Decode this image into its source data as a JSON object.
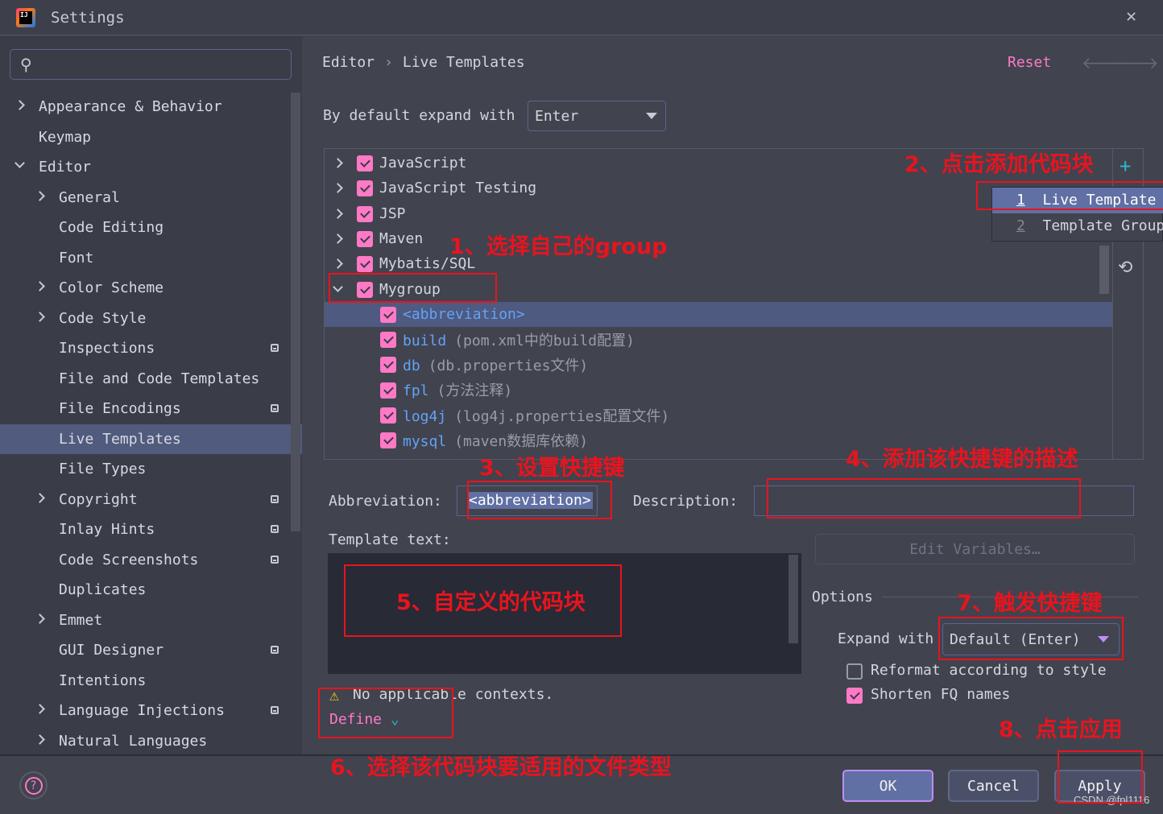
{
  "window": {
    "title": "Settings"
  },
  "search": {
    "placeholder": ""
  },
  "sidebar": {
    "items": [
      {
        "label": "Appearance & Behavior",
        "level": 0,
        "chevron": "closed",
        "badge": false
      },
      {
        "label": "Keymap",
        "level": 0,
        "chevron": "none",
        "badge": false
      },
      {
        "label": "Editor",
        "level": 0,
        "chevron": "open",
        "badge": false
      },
      {
        "label": "General",
        "level": 1,
        "chevron": "closed",
        "badge": false
      },
      {
        "label": "Code Editing",
        "level": 1,
        "chevron": "none",
        "badge": false
      },
      {
        "label": "Font",
        "level": 1,
        "chevron": "none",
        "badge": false
      },
      {
        "label": "Color Scheme",
        "level": 1,
        "chevron": "closed",
        "badge": false
      },
      {
        "label": "Code Style",
        "level": 1,
        "chevron": "closed",
        "badge": false
      },
      {
        "label": "Inspections",
        "level": 1,
        "chevron": "none",
        "badge": true
      },
      {
        "label": "File and Code Templates",
        "level": 1,
        "chevron": "none",
        "badge": false
      },
      {
        "label": "File Encodings",
        "level": 1,
        "chevron": "none",
        "badge": true
      },
      {
        "label": "Live Templates",
        "level": 1,
        "chevron": "none",
        "badge": false,
        "selected": true
      },
      {
        "label": "File Types",
        "level": 1,
        "chevron": "none",
        "badge": false
      },
      {
        "label": "Copyright",
        "level": 1,
        "chevron": "closed",
        "badge": true
      },
      {
        "label": "Inlay Hints",
        "level": 1,
        "chevron": "none",
        "badge": true
      },
      {
        "label": "Code Screenshots",
        "level": 1,
        "chevron": "none",
        "badge": true
      },
      {
        "label": "Duplicates",
        "level": 1,
        "chevron": "none",
        "badge": false
      },
      {
        "label": "Emmet",
        "level": 1,
        "chevron": "closed",
        "badge": false
      },
      {
        "label": "GUI Designer",
        "level": 1,
        "chevron": "none",
        "badge": true
      },
      {
        "label": "Intentions",
        "level": 1,
        "chevron": "none",
        "badge": false
      },
      {
        "label": "Language Injections",
        "level": 1,
        "chevron": "closed",
        "badge": true
      },
      {
        "label": "Natural Languages",
        "level": 1,
        "chevron": "closed",
        "badge": false
      }
    ]
  },
  "header": {
    "breadcrumb": [
      "Editor",
      "Live Templates"
    ],
    "separator": "›",
    "reset": "Reset"
  },
  "expand_default": {
    "label": "By default expand with",
    "value": "Enter"
  },
  "tree": {
    "rows": [
      {
        "abbr": "JavaScript",
        "group": true,
        "chevron": "closed"
      },
      {
        "abbr": "JavaScript Testing",
        "group": true,
        "chevron": "closed"
      },
      {
        "abbr": "JSP",
        "group": true,
        "chevron": "closed"
      },
      {
        "abbr": "Maven",
        "group": true,
        "chevron": "closed"
      },
      {
        "abbr": "Mybatis/SQL",
        "group": true,
        "chevron": "closed"
      },
      {
        "abbr": "Mygroup",
        "group": true,
        "chevron": "open"
      },
      {
        "abbr": "<abbreviation>",
        "desc": "",
        "group": false,
        "selected": true
      },
      {
        "abbr": "build",
        "desc": "(pom.xml中的build配置)",
        "group": false
      },
      {
        "abbr": "db",
        "desc": "(db.properties文件)",
        "group": false
      },
      {
        "abbr": "fpl",
        "desc": "(方法注释)",
        "group": false
      },
      {
        "abbr": "log4j",
        "desc": "(log4j.properties配置文件)",
        "group": false
      },
      {
        "abbr": "mysql",
        "desc": "(maven数据库依赖)",
        "group": false
      }
    ]
  },
  "popup": {
    "items": [
      {
        "key": "1",
        "label": "Live Template"
      },
      {
        "key": "2",
        "label": "Template Group"
      }
    ]
  },
  "editor": {
    "abbreviation_label": "Abbreviation:",
    "abbreviation_value": "<abbreviation>",
    "description_label": "Description:",
    "description_value": "",
    "template_text_label": "Template text:",
    "template_text": "",
    "edit_variables": "Edit Variables…",
    "warning": "No applicable contexts.",
    "define": "Define",
    "options_label": "Options",
    "expand_with_label": "Expand with",
    "expand_with_value": "Default (Enter)",
    "reformat": {
      "label": "Reformat according to style",
      "checked": false
    },
    "shorten": {
      "label": "Shorten FQ names",
      "checked": true
    }
  },
  "buttons": {
    "ok": "OK",
    "cancel": "Cancel",
    "apply": "Apply",
    "help": "?"
  },
  "annotations": {
    "n1": "1、选择自己的group",
    "n2": "2、点击添加代码块",
    "n3": "3、设置快捷键",
    "n4": "4、添加该快捷键的描述",
    "n5": "5、自定义的代码块",
    "n6": "6、选择该代码块要适用的文件类型",
    "n7": "7、触发快捷键",
    "n8": "8、点击应用"
  },
  "watermark": "CSDN @fpl1116",
  "colors": {
    "accent_pink": "#ff79c6",
    "link_blue": "#62a3f5",
    "selection": "#505b7d",
    "annotation_red": "#e8141e",
    "add_icon": "#2fb4c8"
  }
}
